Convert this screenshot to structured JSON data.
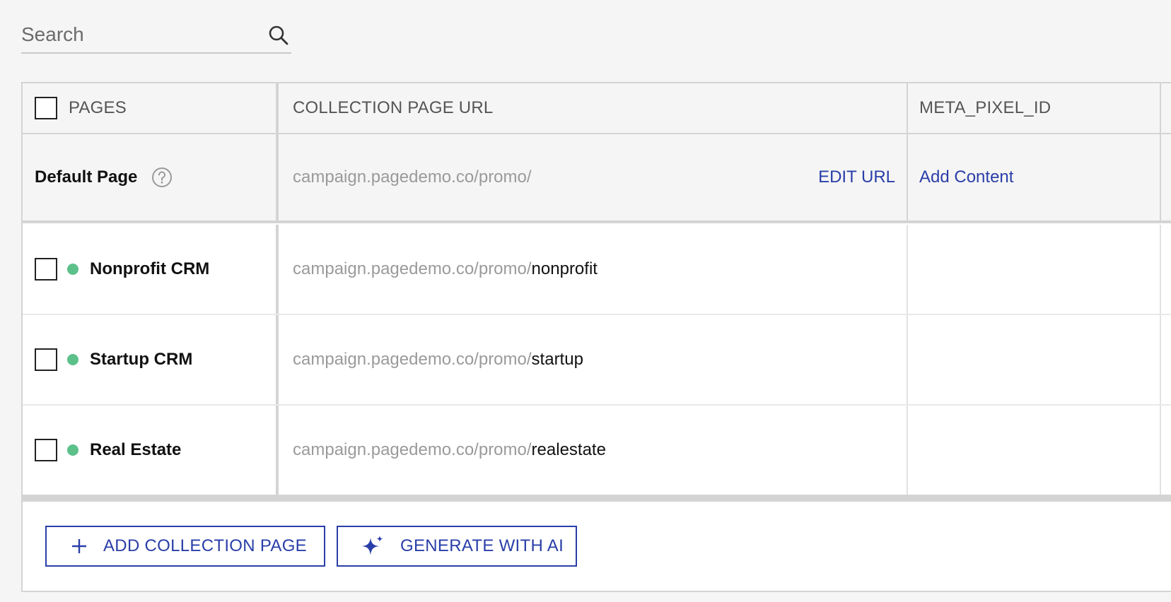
{
  "search": {
    "placeholder": "Search",
    "icon": "search-icon"
  },
  "table": {
    "columns": [
      "PAGES",
      "COLLECTION PAGE URL",
      "META_PIXEL_ID"
    ],
    "default_row": {
      "name": "Default Page",
      "url_base": "campaign.pagedemo.co/promo/",
      "edit_label": "EDIT URL",
      "meta_action": "Add Content"
    },
    "rows": [
      {
        "name": "Nonprofit CRM",
        "url_base": "campaign.pagedemo.co/promo/",
        "slug": "nonprofit",
        "status": "published"
      },
      {
        "name": "Startup CRM",
        "url_base": "campaign.pagedemo.co/promo/",
        "slug": "startup",
        "status": "published"
      },
      {
        "name": "Real Estate",
        "url_base": "campaign.pagedemo.co/promo/",
        "slug": "realestate",
        "status": "published"
      }
    ]
  },
  "actions": {
    "add_label": "ADD COLLECTION PAGE",
    "generate_label": "GENERATE WITH AI"
  },
  "colors": {
    "accent": "#2a3ea8",
    "status_dot": "#5cc08a"
  }
}
